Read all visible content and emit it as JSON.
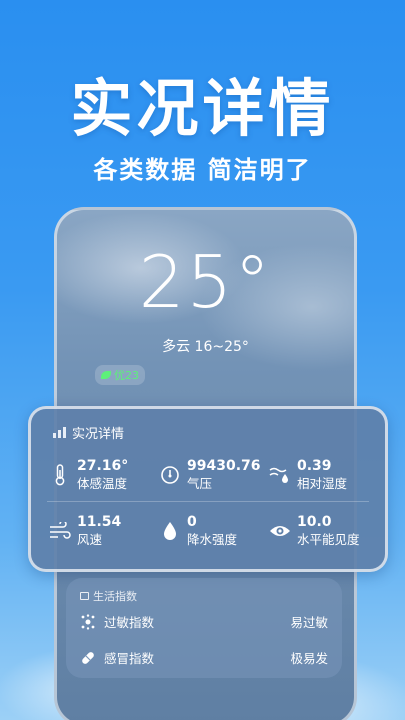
{
  "hero": {
    "title": "实况详情",
    "subtitle": "各类数据 简洁明了"
  },
  "weather": {
    "temperature": "25°",
    "condition": "多云 16~25°",
    "aqi": "优23"
  },
  "details": {
    "title": "实况详情",
    "metrics": [
      {
        "value": "27.16°",
        "label": "体感温度",
        "icon": "thermometer-icon"
      },
      {
        "value": "99430.76",
        "label": "气压",
        "icon": "gauge-icon"
      },
      {
        "value": "0.39",
        "label": "相对湿度",
        "icon": "humidity-icon"
      },
      {
        "value": "11.54",
        "label": "风速",
        "icon": "wind-icon"
      },
      {
        "value": "0",
        "label": "降水强度",
        "icon": "raindrop-icon"
      },
      {
        "value": "10.0",
        "label": "水平能见度",
        "icon": "eye-icon"
      }
    ]
  },
  "life": {
    "title": "生活指数",
    "items": [
      {
        "name": "过敏指数",
        "value": "易过敏",
        "icon": "allergy-icon"
      },
      {
        "name": "感冒指数",
        "value": "极易发",
        "icon": "pill-icon"
      }
    ]
  },
  "colors": {
    "aqi_good": "#5df07a",
    "background": "#2a8ff0"
  }
}
